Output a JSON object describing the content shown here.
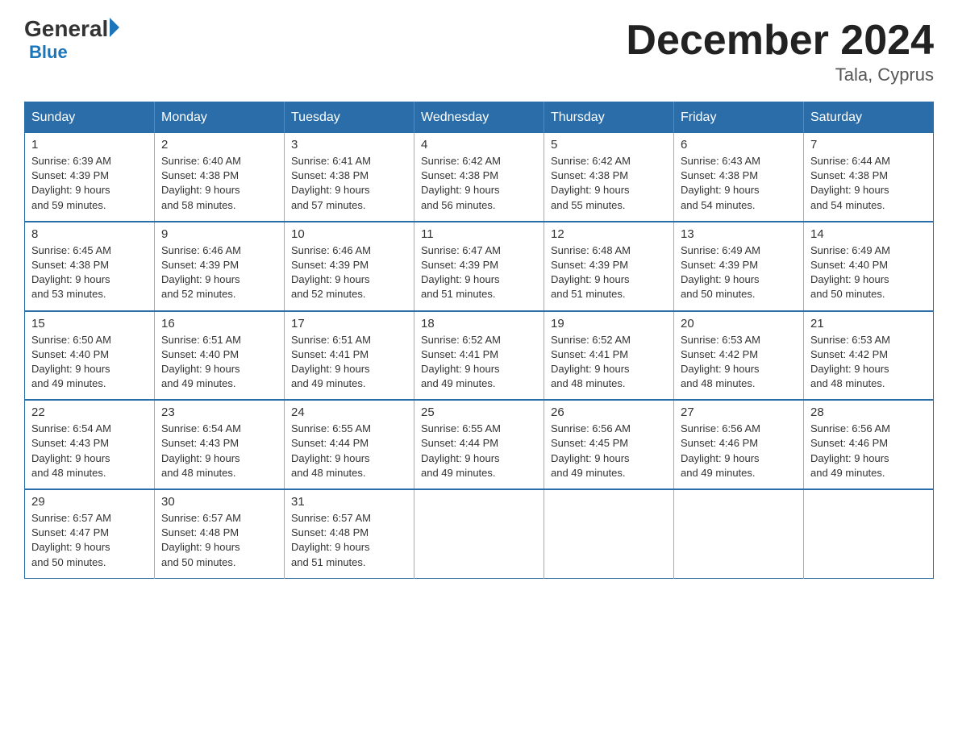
{
  "header": {
    "logo_general": "General",
    "logo_blue": "Blue",
    "title": "December 2024",
    "location": "Tala, Cyprus"
  },
  "days_of_week": [
    "Sunday",
    "Monday",
    "Tuesday",
    "Wednesday",
    "Thursday",
    "Friday",
    "Saturday"
  ],
  "weeks": [
    [
      {
        "day": "1",
        "sunrise": "6:39 AM",
        "sunset": "4:39 PM",
        "daylight": "9 hours and 59 minutes."
      },
      {
        "day": "2",
        "sunrise": "6:40 AM",
        "sunset": "4:38 PM",
        "daylight": "9 hours and 58 minutes."
      },
      {
        "day": "3",
        "sunrise": "6:41 AM",
        "sunset": "4:38 PM",
        "daylight": "9 hours and 57 minutes."
      },
      {
        "day": "4",
        "sunrise": "6:42 AM",
        "sunset": "4:38 PM",
        "daylight": "9 hours and 56 minutes."
      },
      {
        "day": "5",
        "sunrise": "6:42 AM",
        "sunset": "4:38 PM",
        "daylight": "9 hours and 55 minutes."
      },
      {
        "day": "6",
        "sunrise": "6:43 AM",
        "sunset": "4:38 PM",
        "daylight": "9 hours and 54 minutes."
      },
      {
        "day": "7",
        "sunrise": "6:44 AM",
        "sunset": "4:38 PM",
        "daylight": "9 hours and 54 minutes."
      }
    ],
    [
      {
        "day": "8",
        "sunrise": "6:45 AM",
        "sunset": "4:38 PM",
        "daylight": "9 hours and 53 minutes."
      },
      {
        "day": "9",
        "sunrise": "6:46 AM",
        "sunset": "4:39 PM",
        "daylight": "9 hours and 52 minutes."
      },
      {
        "day": "10",
        "sunrise": "6:46 AM",
        "sunset": "4:39 PM",
        "daylight": "9 hours and 52 minutes."
      },
      {
        "day": "11",
        "sunrise": "6:47 AM",
        "sunset": "4:39 PM",
        "daylight": "9 hours and 51 minutes."
      },
      {
        "day": "12",
        "sunrise": "6:48 AM",
        "sunset": "4:39 PM",
        "daylight": "9 hours and 51 minutes."
      },
      {
        "day": "13",
        "sunrise": "6:49 AM",
        "sunset": "4:39 PM",
        "daylight": "9 hours and 50 minutes."
      },
      {
        "day": "14",
        "sunrise": "6:49 AM",
        "sunset": "4:40 PM",
        "daylight": "9 hours and 50 minutes."
      }
    ],
    [
      {
        "day": "15",
        "sunrise": "6:50 AM",
        "sunset": "4:40 PM",
        "daylight": "9 hours and 49 minutes."
      },
      {
        "day": "16",
        "sunrise": "6:51 AM",
        "sunset": "4:40 PM",
        "daylight": "9 hours and 49 minutes."
      },
      {
        "day": "17",
        "sunrise": "6:51 AM",
        "sunset": "4:41 PM",
        "daylight": "9 hours and 49 minutes."
      },
      {
        "day": "18",
        "sunrise": "6:52 AM",
        "sunset": "4:41 PM",
        "daylight": "9 hours and 49 minutes."
      },
      {
        "day": "19",
        "sunrise": "6:52 AM",
        "sunset": "4:41 PM",
        "daylight": "9 hours and 48 minutes."
      },
      {
        "day": "20",
        "sunrise": "6:53 AM",
        "sunset": "4:42 PM",
        "daylight": "9 hours and 48 minutes."
      },
      {
        "day": "21",
        "sunrise": "6:53 AM",
        "sunset": "4:42 PM",
        "daylight": "9 hours and 48 minutes."
      }
    ],
    [
      {
        "day": "22",
        "sunrise": "6:54 AM",
        "sunset": "4:43 PM",
        "daylight": "9 hours and 48 minutes."
      },
      {
        "day": "23",
        "sunrise": "6:54 AM",
        "sunset": "4:43 PM",
        "daylight": "9 hours and 48 minutes."
      },
      {
        "day": "24",
        "sunrise": "6:55 AM",
        "sunset": "4:44 PM",
        "daylight": "9 hours and 48 minutes."
      },
      {
        "day": "25",
        "sunrise": "6:55 AM",
        "sunset": "4:44 PM",
        "daylight": "9 hours and 49 minutes."
      },
      {
        "day": "26",
        "sunrise": "6:56 AM",
        "sunset": "4:45 PM",
        "daylight": "9 hours and 49 minutes."
      },
      {
        "day": "27",
        "sunrise": "6:56 AM",
        "sunset": "4:46 PM",
        "daylight": "9 hours and 49 minutes."
      },
      {
        "day": "28",
        "sunrise": "6:56 AM",
        "sunset": "4:46 PM",
        "daylight": "9 hours and 49 minutes."
      }
    ],
    [
      {
        "day": "29",
        "sunrise": "6:57 AM",
        "sunset": "4:47 PM",
        "daylight": "9 hours and 50 minutes."
      },
      {
        "day": "30",
        "sunrise": "6:57 AM",
        "sunset": "4:48 PM",
        "daylight": "9 hours and 50 minutes."
      },
      {
        "day": "31",
        "sunrise": "6:57 AM",
        "sunset": "4:48 PM",
        "daylight": "9 hours and 51 minutes."
      },
      null,
      null,
      null,
      null
    ]
  ],
  "labels": {
    "sunrise": "Sunrise:",
    "sunset": "Sunset:",
    "daylight": "Daylight:"
  }
}
